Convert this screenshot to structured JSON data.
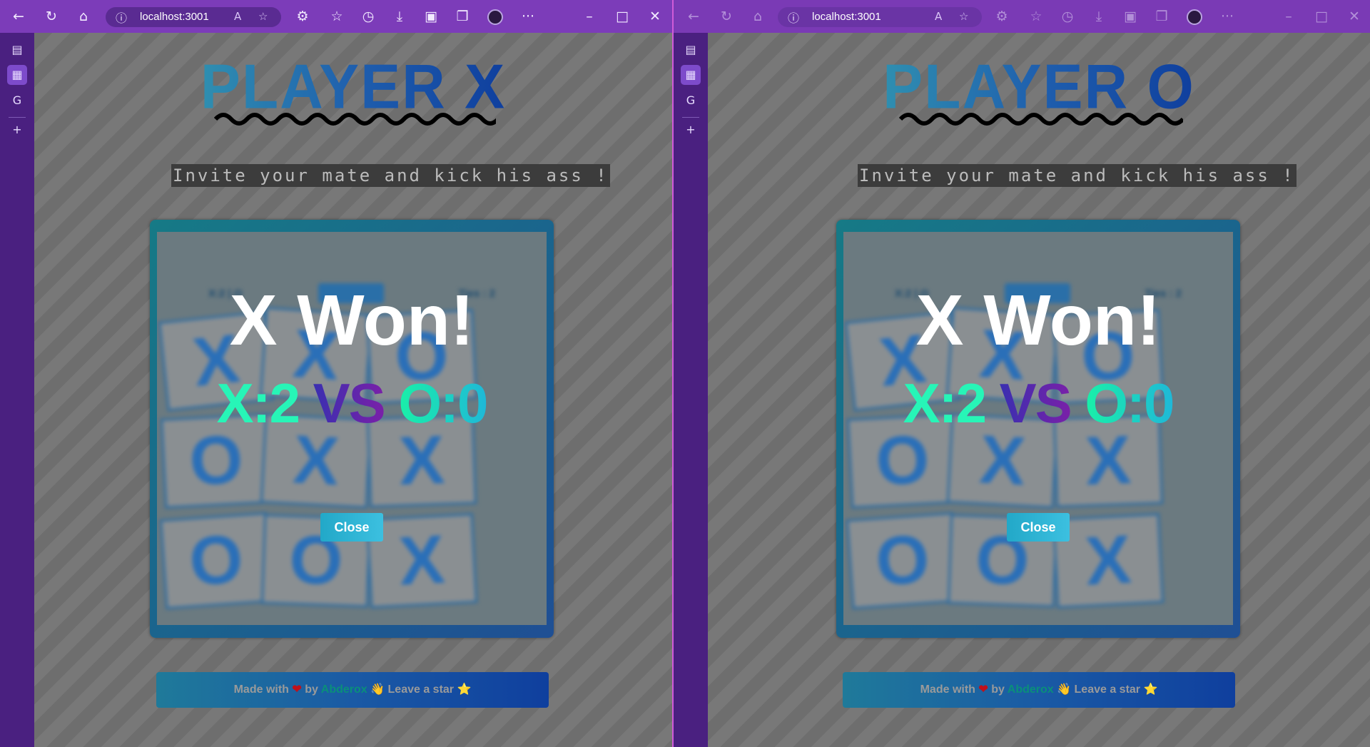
{
  "windows": [
    {
      "id": "left",
      "address_bar": {
        "url": "localhost:3001"
      },
      "page": {
        "title": "PLAYER X",
        "tagline": "Invite your mate and kick his ass !",
        "stats": {
          "left": "X:2 | O",
          "right": "Ties : 2"
        },
        "cells": [
          "X",
          "X",
          "O",
          "O",
          "X",
          "X",
          "O",
          "O",
          "X"
        ],
        "result": {
          "title": "X Won!",
          "score_x": "X:2",
          "score_vs": "VS",
          "score_o": "O:0",
          "close_label": "Close"
        },
        "footer": {
          "made_with": "Made with",
          "by": "by",
          "author": "Abderox",
          "star_text": "Leave a star",
          "heart": "❤",
          "wave": "👋",
          "star": "⭐"
        }
      }
    },
    {
      "id": "right",
      "address_bar": {
        "url": "localhost:3001"
      },
      "page": {
        "title": "PLAYER O",
        "tagline": "Invite your mate and kick his ass !",
        "stats": {
          "left": "X:2 | O",
          "right": "Ties : 2"
        },
        "cells": [
          "X",
          "X",
          "O",
          "O",
          "X",
          "X",
          "O",
          "O",
          "X"
        ],
        "result": {
          "title": "X Won!",
          "score_x": "X:2",
          "score_vs": "VS",
          "score_o": "O:0",
          "close_label": "Close"
        },
        "footer": {
          "made_with": "Made with",
          "by": "by",
          "author": "Abderox",
          "star_text": "Leave a star",
          "heart": "❤",
          "wave": "👋",
          "star": "⭐"
        }
      }
    }
  ],
  "icons": {
    "back": "back-arrow-icon",
    "refresh": "refresh-icon",
    "home": "home-icon",
    "info": "site-info-icon",
    "read_aloud": "read-aloud-icon",
    "add_favorite": "add-favorite-icon",
    "extensions": "extensions-icon",
    "favorites": "favorites-icon",
    "history": "history-icon",
    "downloads": "downloads-icon",
    "collections": "collections-icon",
    "tabs": "tab-actions-icon",
    "more": "more-icon",
    "minimize": "minimize-icon",
    "maximize": "maximize-icon",
    "close": "close-icon"
  },
  "colors": {
    "titlebar": "#7c3cb9",
    "sidebar": "#4a2080",
    "accent_teal": "#27f5b7",
    "board_gradient_start": "#167a86",
    "board_gradient_end": "#1f4f94"
  }
}
